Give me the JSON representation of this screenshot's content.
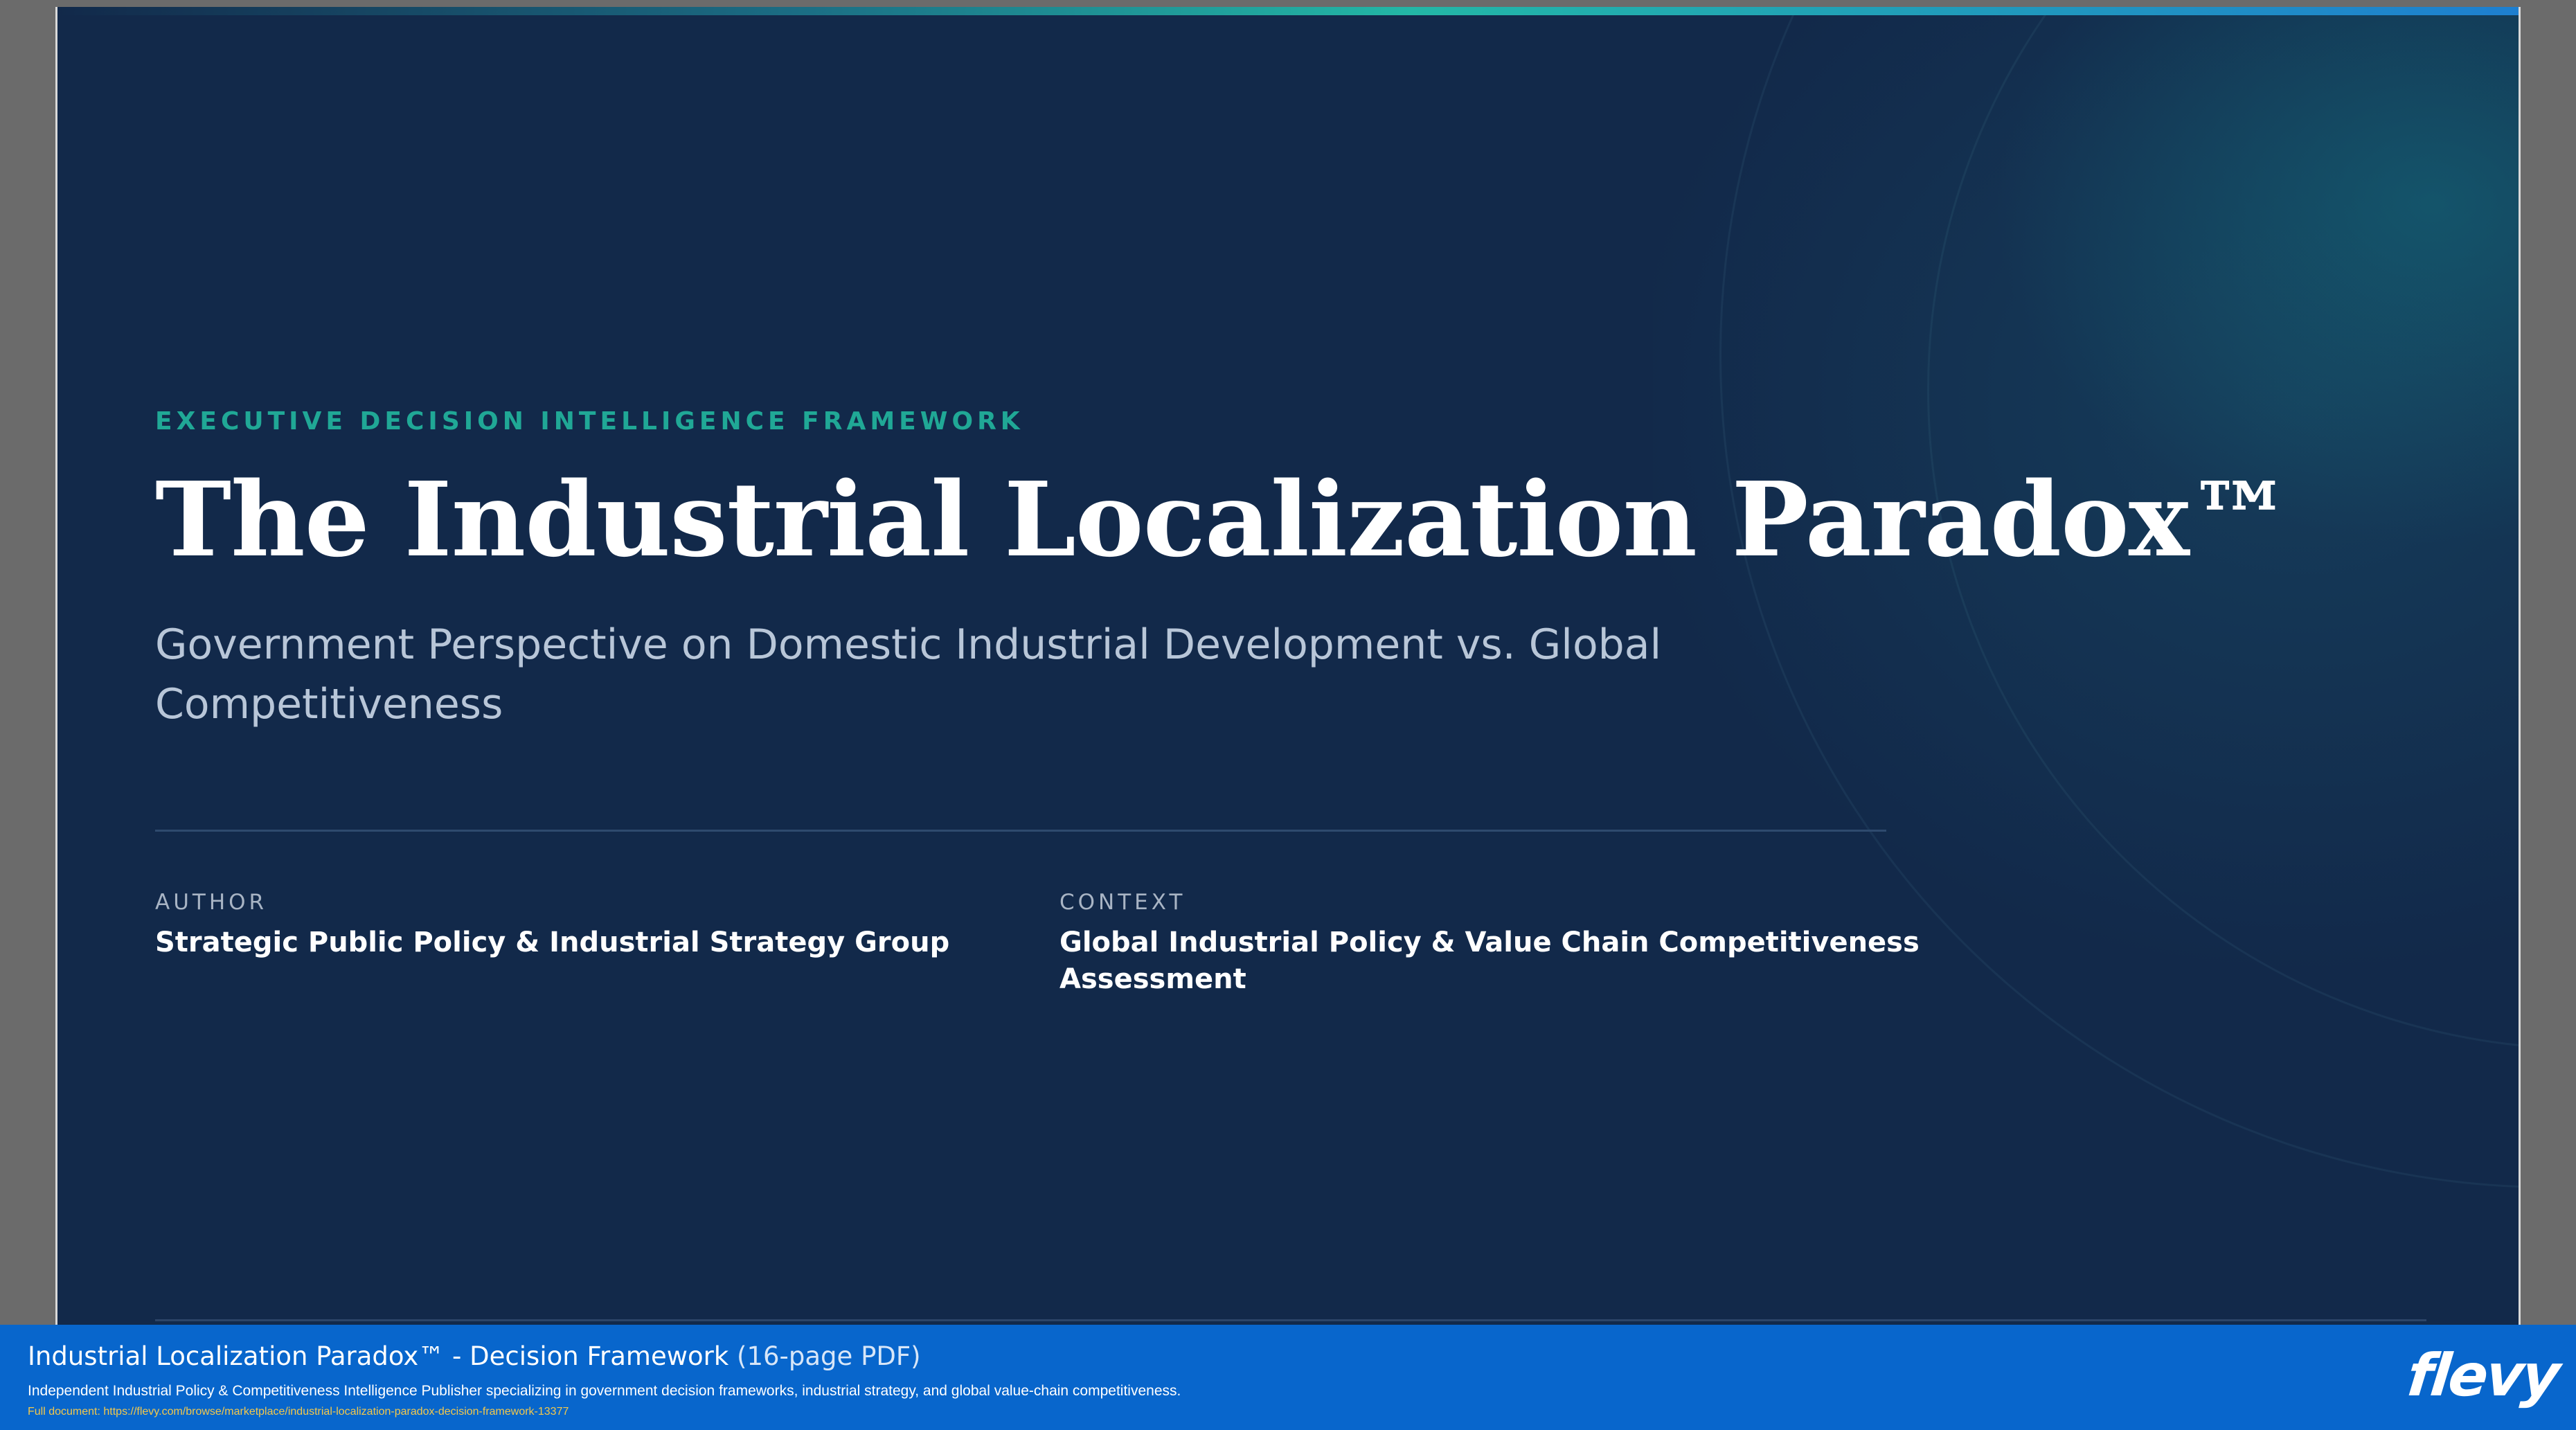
{
  "slide": {
    "eyebrow": "EXECUTIVE DECISION INTELLIGENCE FRAMEWORK",
    "title": "The Industrial Localization Paradox™",
    "subtitle": "Government Perspective on Domestic Industrial Development vs. Global Competitiveness",
    "author": {
      "label": "AUTHOR",
      "value": "Strategic Public Policy & Industrial Strategy Group"
    },
    "context": {
      "label": "CONTEXT",
      "value": "Global Industrial Policy & Value Chain Competitiveness Assessment"
    }
  },
  "banner": {
    "title": "Industrial Localization Paradox™ - Decision Framework",
    "pages": "(16-page PDF)",
    "description": "Independent Industrial Policy & Competitiveness Intelligence Publisher specializing in government decision frameworks, industrial strategy, and global value-chain competitiveness.",
    "link_text": "Full document: https://flevy.com/browse/marketplace/industrial-localization-paradox-decision-framework-13377",
    "logo": "flevy"
  },
  "colors": {
    "slide_bg": "#12294a",
    "accent_teal": "#20a896",
    "banner_blue": "#0866cc",
    "link_yellow": "#f3c84b"
  }
}
